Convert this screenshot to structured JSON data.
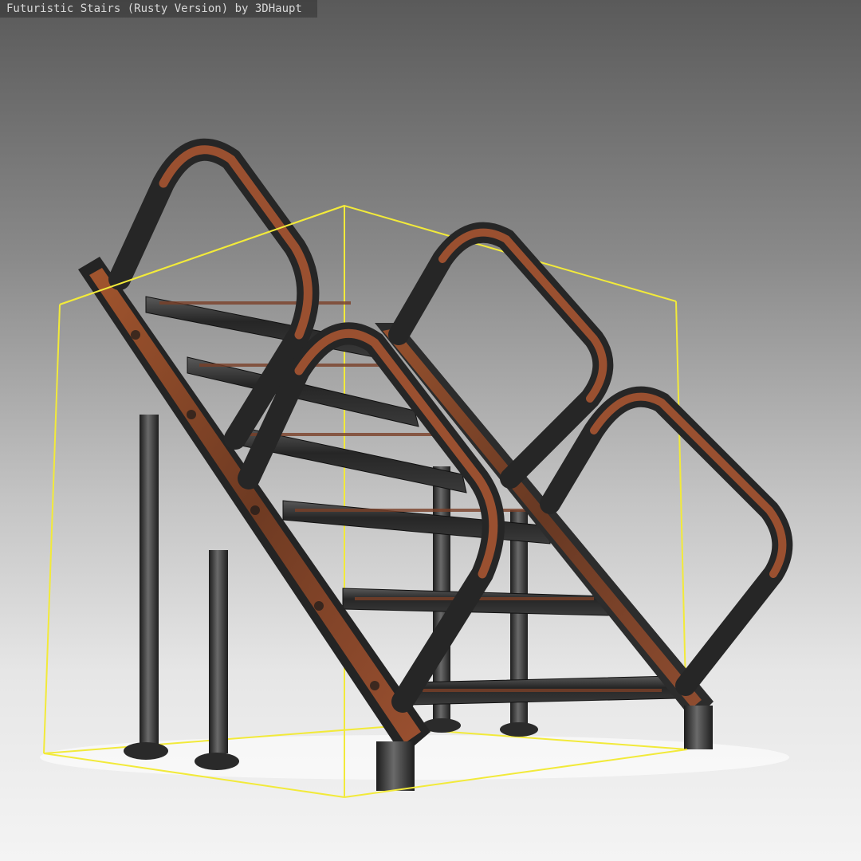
{
  "viewer": {
    "title": "Futuristic Stairs (Rusty Version) by 3DHaupt"
  },
  "colors": {
    "bounding_box": "#f2ea3a",
    "rust": "#8e4a2a",
    "metal_dark": "#2a2a2a",
    "metal_mid": "#4a4a4a",
    "background_top": "#5a5a5a",
    "background_bottom": "#f4f4f4"
  },
  "model": {
    "step_count": 6,
    "handrail_count": 4,
    "support_leg_count": 4
  }
}
